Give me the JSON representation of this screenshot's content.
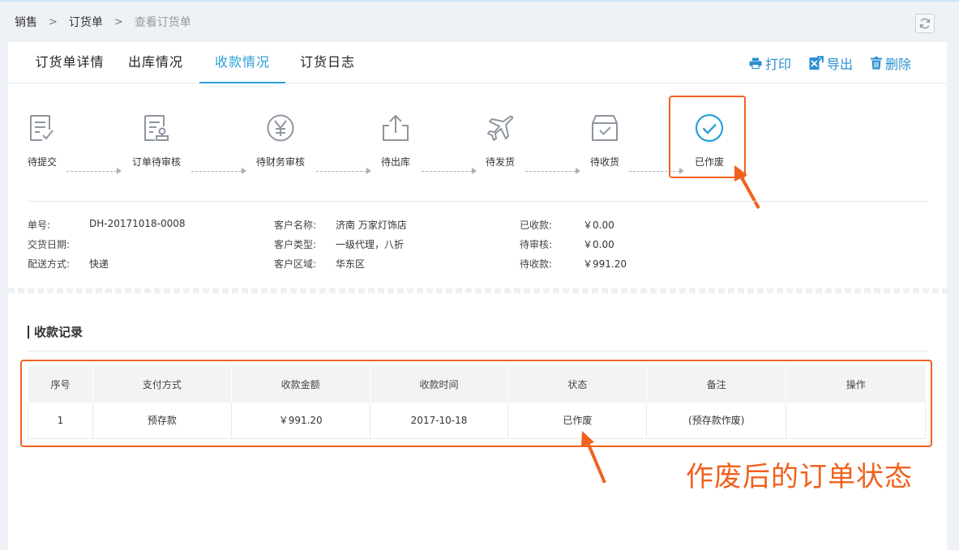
{
  "breadcrumb": {
    "level1": "销售",
    "level2": "订货单",
    "current": "查看订货单",
    "sep": ">"
  },
  "tabs": [
    {
      "label": "订货单详情"
    },
    {
      "label": "出库情况"
    },
    {
      "label": "收款情况"
    },
    {
      "label": "订货日志"
    }
  ],
  "active_tab": "收款情况",
  "actions": {
    "print": "打印",
    "export": "导出",
    "delete": "删除"
  },
  "steps": [
    {
      "label": "待提交",
      "icon": "document-check-icon"
    },
    {
      "label": "订单待审核",
      "icon": "document-stamp-icon"
    },
    {
      "label": "待财务审核",
      "icon": "yen-circle-icon"
    },
    {
      "label": "待出库",
      "icon": "share-out-icon"
    },
    {
      "label": "待发货",
      "icon": "airplane-icon"
    },
    {
      "label": "待收货",
      "icon": "box-check-icon"
    },
    {
      "label": "已作废",
      "icon": "check-circle-icon",
      "active": true
    }
  ],
  "order": {
    "no_label": "单号:",
    "no": "DH-20171018-0008",
    "delivery_date_label": "交货日期:",
    "delivery_date": "",
    "shipping_label": "配送方式:",
    "shipping": "快递",
    "customer_name_label": "客户名称:",
    "customer_name": "济南 万家灯饰店",
    "customer_type_label": "客户类型:",
    "customer_type": "一级代理，八折",
    "customer_area_label": "客户区域:",
    "customer_area": "华东区",
    "received_label": "已收款:",
    "received": "￥0.00",
    "pending_review_label": "待审核:",
    "pending_review": "￥0.00",
    "pending_receive_label": "待收款:",
    "pending_receive": "￥991.20"
  },
  "records": {
    "title": "收款记录",
    "columns": [
      "序号",
      "支付方式",
      "收款金额",
      "收款时间",
      "状态",
      "备注",
      "操作"
    ],
    "rows": [
      [
        "1",
        "预存款",
        "￥991.20",
        "2017-10-18",
        "已作废",
        "(预存款作废)",
        ""
      ]
    ]
  },
  "annotation": "作废后的订单状态",
  "colors": {
    "accent": "#2aa0d8",
    "annotation": "#f0621e",
    "icon": "#8e969e"
  }
}
